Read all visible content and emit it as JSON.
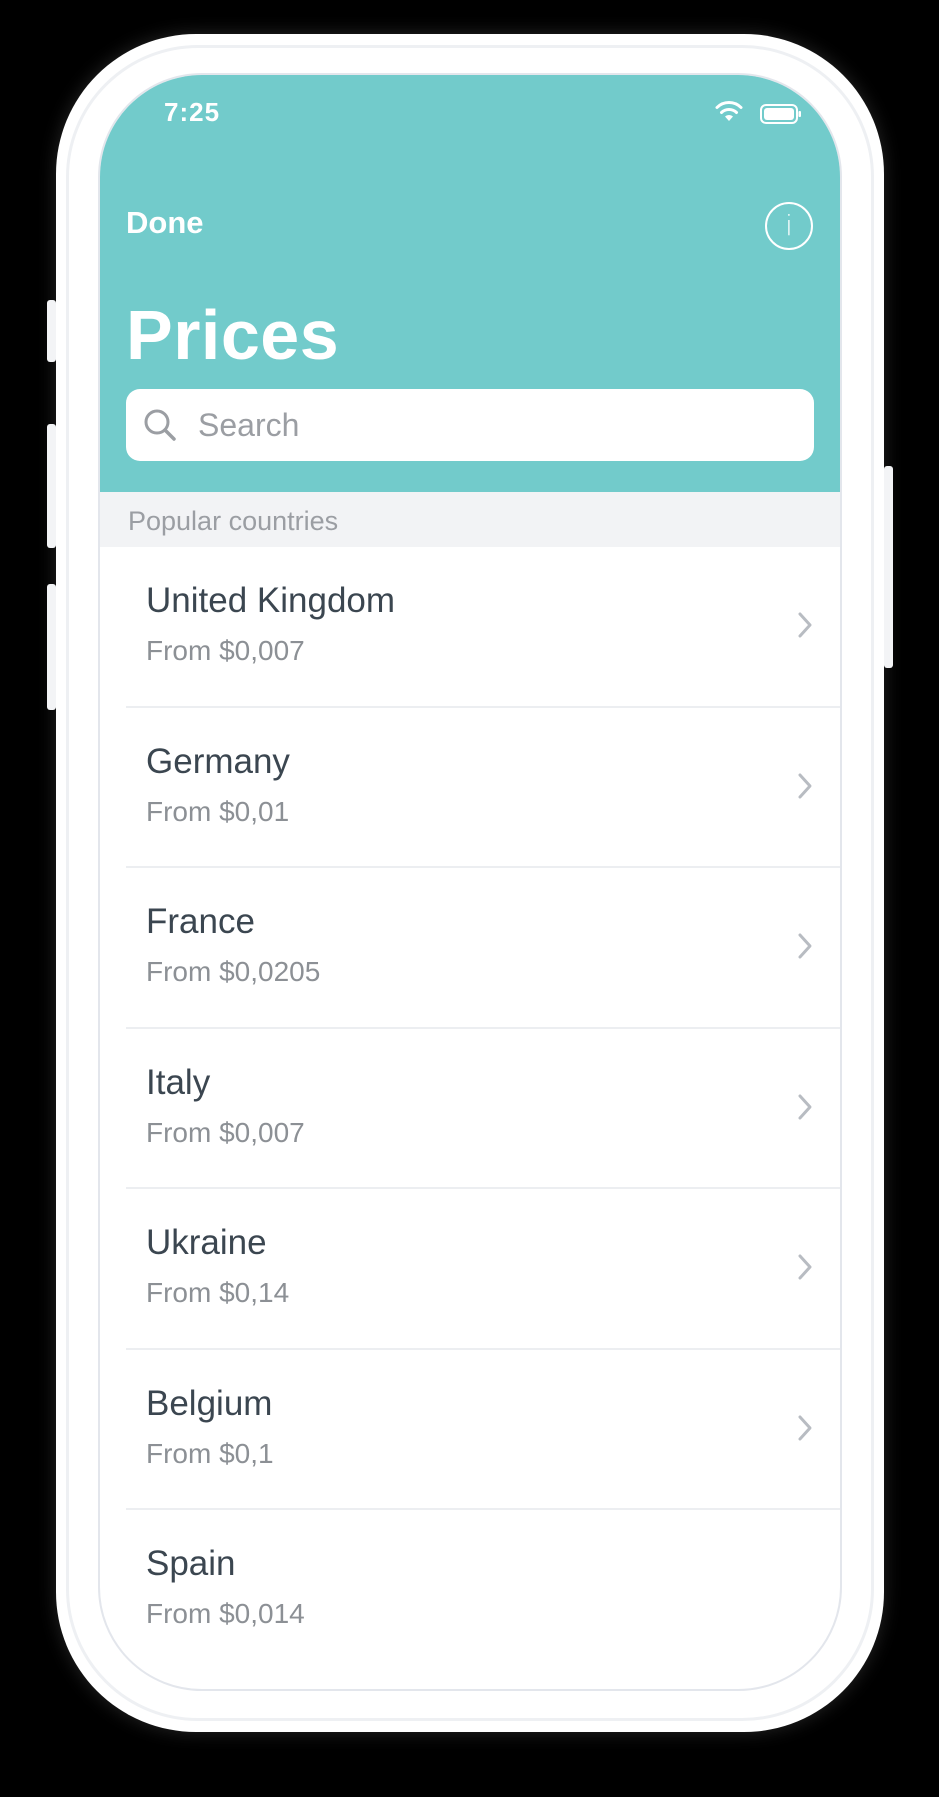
{
  "status_bar": {
    "time": "7:25"
  },
  "nav": {
    "done_label": "Done",
    "info_glyph": "i"
  },
  "page": {
    "title": "Prices"
  },
  "search": {
    "placeholder": "Search",
    "value": ""
  },
  "section": {
    "label": "Popular countries"
  },
  "countries": [
    {
      "name": "United Kingdom",
      "price": "From $0,007"
    },
    {
      "name": "Germany",
      "price": "From $0,01"
    },
    {
      "name": "France",
      "price": "From $0,0205"
    },
    {
      "name": "Italy",
      "price": "From $0,007"
    },
    {
      "name": "Ukraine",
      "price": "From $0,14"
    },
    {
      "name": "Belgium",
      "price": "From $0,1"
    },
    {
      "name": "Spain",
      "price": "From $0,014"
    }
  ],
  "colors": {
    "header_bg": "#72cbcb",
    "section_bg": "#f2f3f5",
    "text_primary": "#3b4650",
    "text_secondary": "#8c9095"
  },
  "icons": [
    "wifi-icon",
    "battery-icon",
    "info-icon",
    "search-icon",
    "chevron-right-icon"
  ]
}
